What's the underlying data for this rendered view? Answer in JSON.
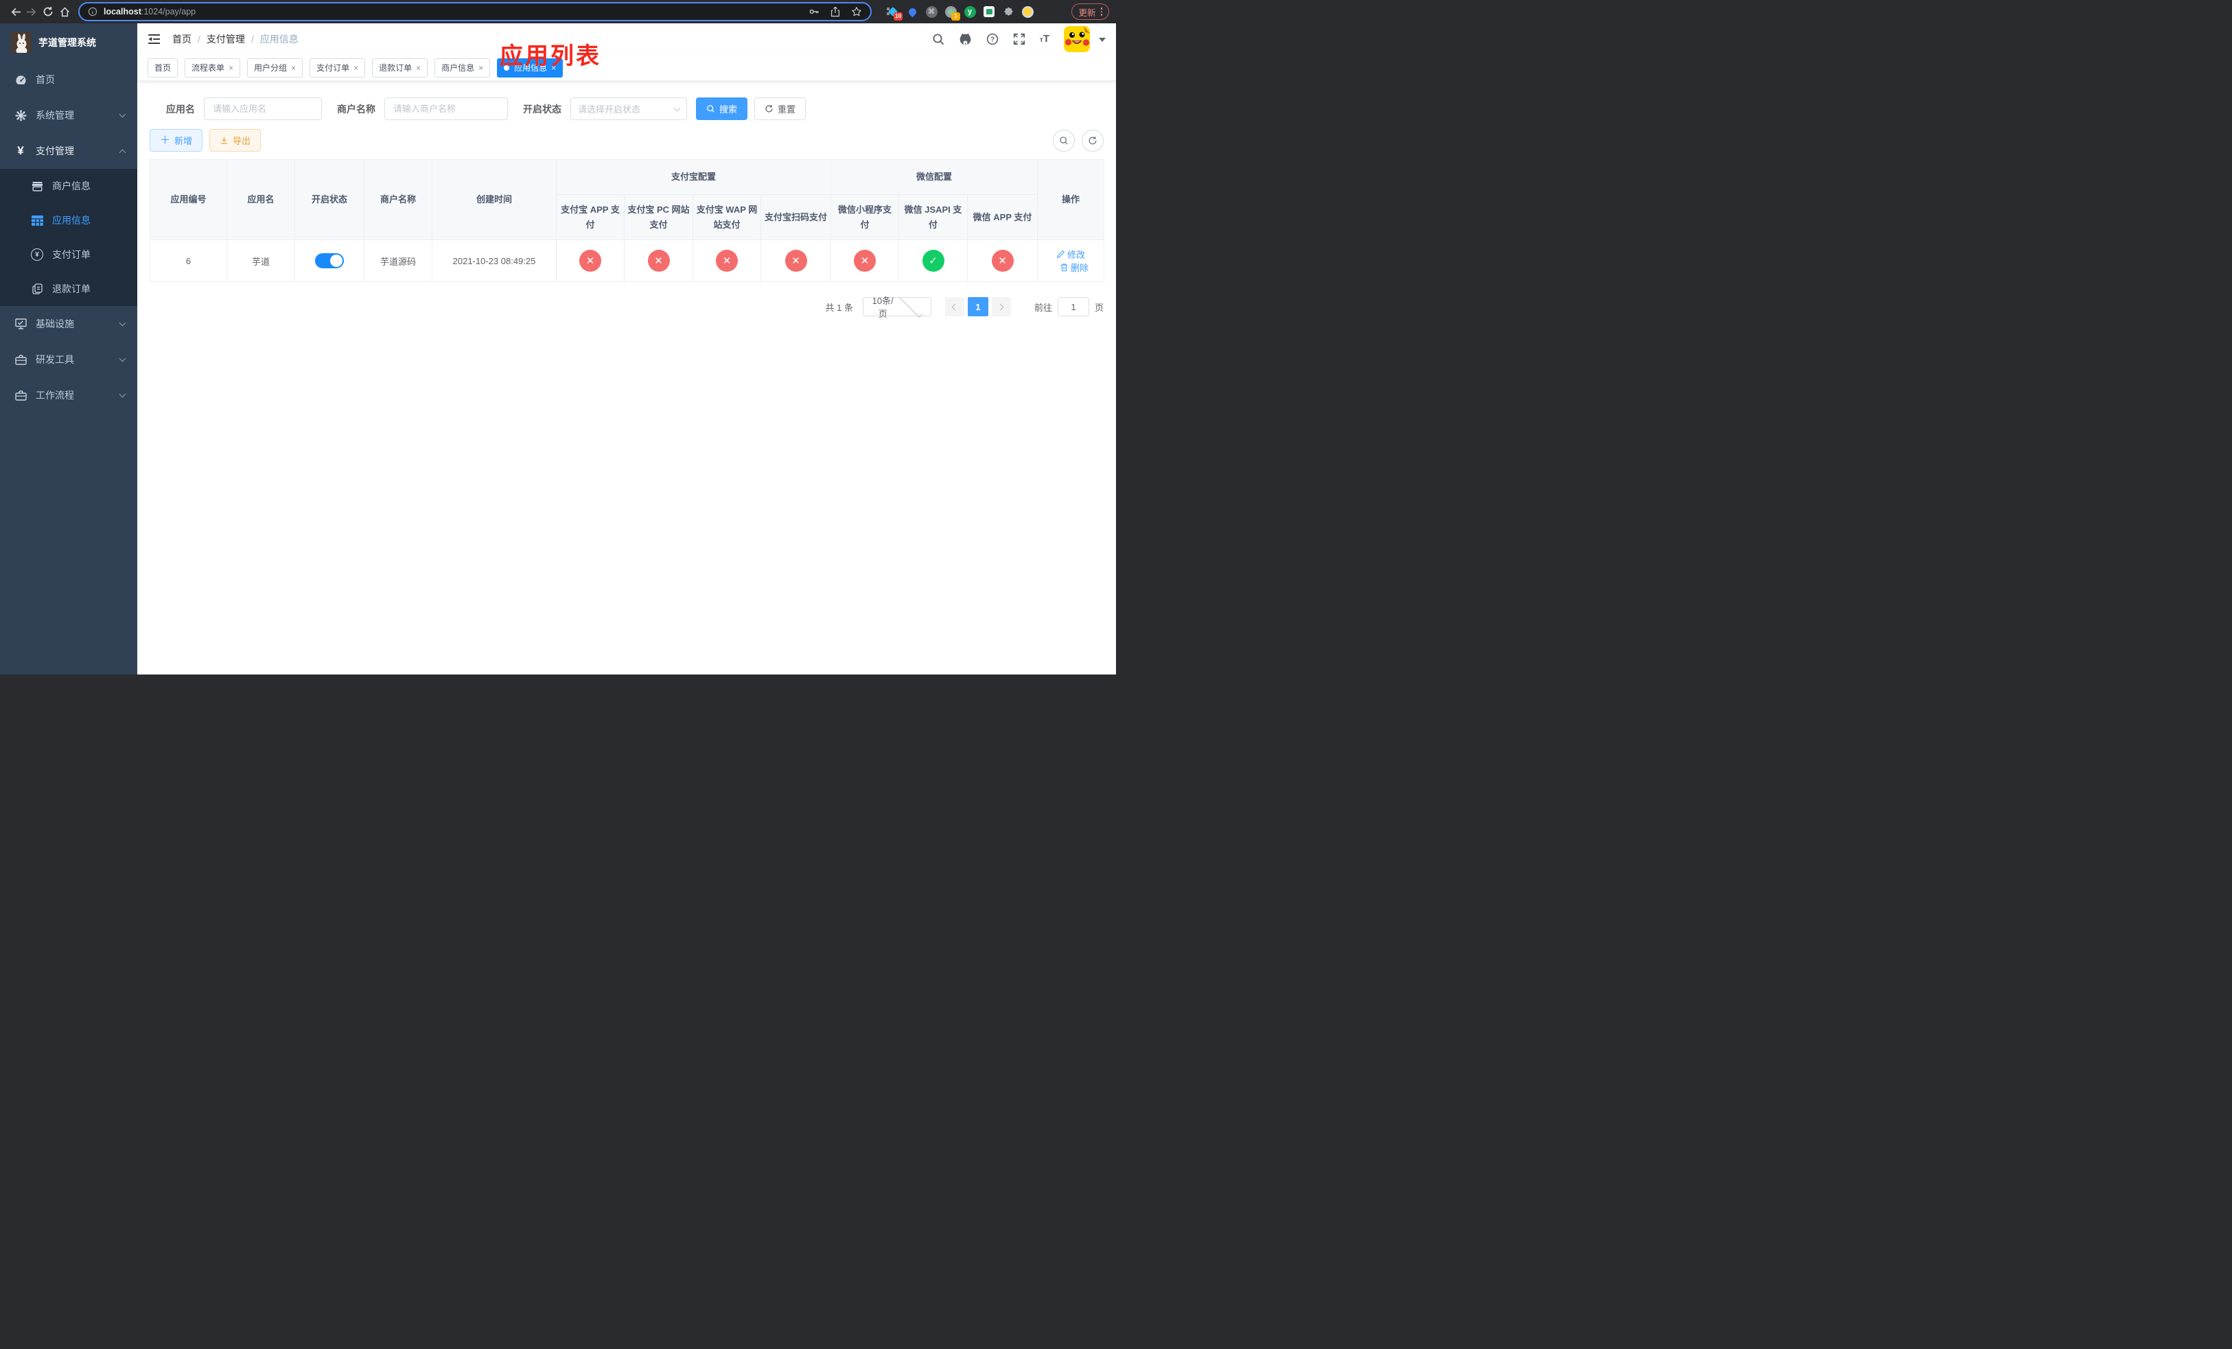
{
  "browser": {
    "url_host": "localhost",
    "url_path": ":1024/pay/app",
    "update_label": "更新",
    "ext_badge_blue": "10",
    "ext_badge_rec": "1"
  },
  "sidebar": {
    "title": "芋道管理系统",
    "items": [
      {
        "label": "首页"
      },
      {
        "label": "系统管理"
      },
      {
        "label": "支付管理"
      },
      {
        "label": "基础设施"
      },
      {
        "label": "研发工具"
      },
      {
        "label": "工作流程"
      }
    ],
    "submenu": [
      {
        "label": "商户信息"
      },
      {
        "label": "应用信息"
      },
      {
        "label": "支付订单"
      },
      {
        "label": "退款订单"
      }
    ]
  },
  "header": {
    "breadcrumb": [
      "首页",
      "支付管理",
      "应用信息"
    ],
    "annotation": "应用列表"
  },
  "tabs": [
    {
      "label": "首页"
    },
    {
      "label": "流程表单"
    },
    {
      "label": "用户分组"
    },
    {
      "label": "支付订单"
    },
    {
      "label": "退款订单"
    },
    {
      "label": "商户信息"
    },
    {
      "label": "应用信息"
    }
  ],
  "filters": {
    "app_name_label": "应用名",
    "app_name_placeholder": "请输入应用名",
    "merchant_label": "商户名称",
    "merchant_placeholder": "请输入商户名称",
    "status_label": "开启状态",
    "status_placeholder": "请选择开启状态",
    "search_label": "搜索",
    "reset_label": "重置"
  },
  "toolbar": {
    "add_label": "新增",
    "export_label": "导出"
  },
  "table": {
    "columns": {
      "app_id": "应用编号",
      "app_name": "应用名",
      "status": "开启状态",
      "merchant": "商户名称",
      "created": "创建时间",
      "alipay_group": "支付宝配置",
      "wechat_group": "微信配置",
      "alipay_app": "支付宝 APP 支付",
      "alipay_pc": "支付宝 PC 网站支付",
      "alipay_wap": "支付宝 WAP 网站支付",
      "alipay_qr": "支付宝扫码支付",
      "wx_mini": "微信小程序支付",
      "wx_jsapi": "微信 JSAPI 支付",
      "wx_app": "微信 APP 支付",
      "actions": "操作"
    },
    "row": {
      "app_id": "6",
      "app_name": "芋道",
      "status_on": true,
      "merchant": "芋道源码",
      "created": "2021-10-23 08:49:25",
      "configs": [
        "no",
        "no",
        "no",
        "no",
        "no",
        "yes",
        "no"
      ],
      "edit_label": "修改",
      "delete_label": "删除"
    }
  },
  "pagination": {
    "total": "共 1 条",
    "page_size": "10条/页",
    "page": "1",
    "goto_label": "前往",
    "goto_value": "1",
    "unit_label": "页"
  }
}
